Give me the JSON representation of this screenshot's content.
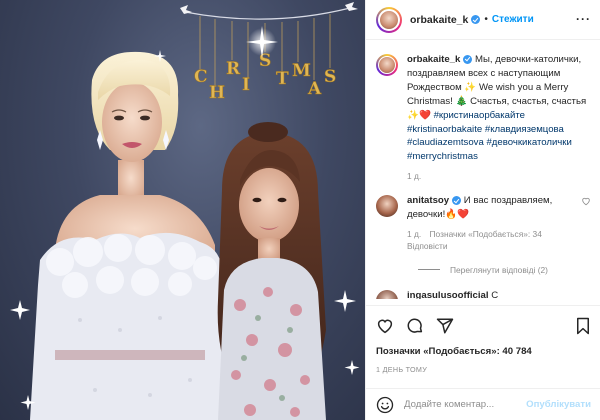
{
  "photo": {
    "decoration_text": "CHRISTMAS"
  },
  "header": {
    "username": "orbakaite_k",
    "separator": "•",
    "follow_label": "Стежити",
    "more_icon": "more-horizontal-icon"
  },
  "caption": {
    "username": "orbakaite_k",
    "text_1": "Мы, девочки-католички, поздравляем всех с наступающим Рождеством ✨ We wish you a Merry Christmas! 🎄 Счастья, счастья, счастья ✨❤️",
    "tags": [
      "#кристинаорбакайте",
      "#kristinaorbakaite",
      "#клавдияземцова",
      "#claudiazemtsova",
      "#девочкикатолички",
      "#merrychristmas"
    ],
    "time": "1 д."
  },
  "comment": {
    "username": "anitatsoy",
    "text": "И вас поздравляем, девочки!🔥❤️",
    "time": "1 д.",
    "likes": "Позначки «Подобається»: 34",
    "reply": "Відповісти",
    "view_replies": "Переглянути відповіді (2)"
  },
  "next_comment": {
    "username": "ingasulusoofficial",
    "text": "С"
  },
  "actions": {
    "icons": [
      "heart-icon",
      "comment-icon",
      "share-icon",
      "bookmark-icon"
    ]
  },
  "likes_text": "Позначки «Подобається»: 40 784",
  "date_text": "1 ДЕНЬ ТОМУ",
  "add_comment": {
    "placeholder": "Додайте коментар...",
    "publish_label": "Опублікувати"
  },
  "colors": {
    "accent": "#0095f6",
    "verified": "#3897f0",
    "publish_disabled": "#b2dffc",
    "muted": "#8e8e8e",
    "hashtag": "#00376b",
    "heart_red": "#ed4956"
  }
}
